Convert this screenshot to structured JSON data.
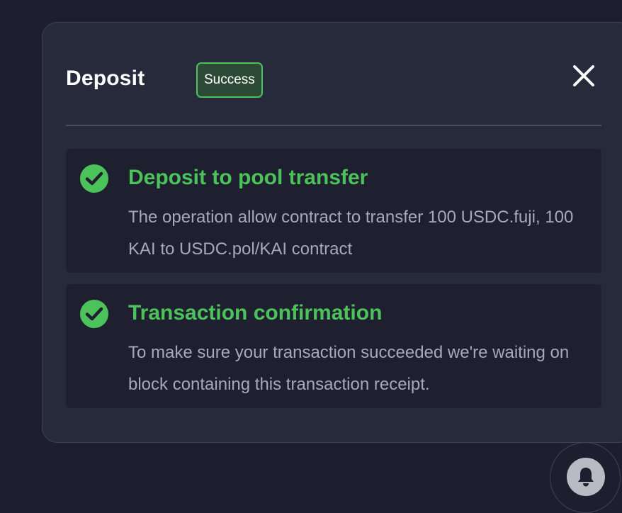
{
  "modal": {
    "title": "Deposit",
    "status_badge": "Success",
    "close_icon": "close-icon",
    "steps": [
      {
        "title": "Deposit to pool transfer",
        "description": "The operation allow contract to transfer 100 USDC.fuji, 100 KAI to USDC.pol/KAI contract",
        "status": "completed",
        "icon": "check-circle-icon"
      },
      {
        "title": "Transaction confirmation",
        "description": "To make sure your transaction succeeded we're waiting on block containing this transaction receipt.",
        "status": "completed",
        "icon": "check-circle-icon"
      }
    ]
  },
  "notifications": {
    "icon": "bell-icon"
  },
  "colors": {
    "background": "#1d1f2e",
    "panel": "#272a3b",
    "card": "#1e2030",
    "success": "#4cc35a",
    "text_muted": "#a7a9b8"
  }
}
